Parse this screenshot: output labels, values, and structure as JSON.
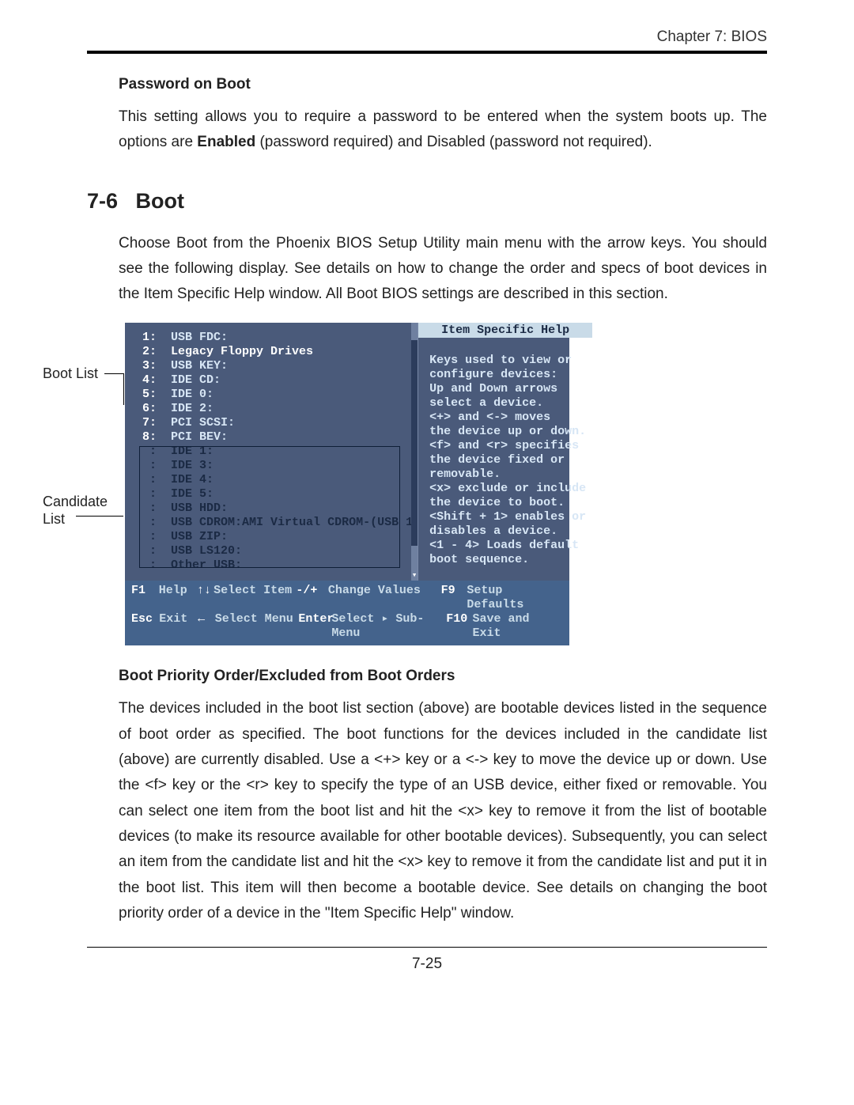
{
  "chapter_header": "Chapter 7: BIOS",
  "password_on_boot": {
    "heading": "Password on Boot",
    "para_pre": "This setting allows you to require a password to be entered when the system boots up.  The options are ",
    "bold": "Enabled",
    "para_post": " (password required) and Disabled (password not required)."
  },
  "section": {
    "num": "7-6",
    "title": "Boot",
    "intro": "Choose Boot from the Phoenix BIOS Setup Utility main menu with the arrow keys.  You should see the following display.  See details on how to change the order and specs of boot devices in the Item Specific Help window.  All Boot BIOS settings are described in this section."
  },
  "fig_labels": {
    "boot_list": "Boot List",
    "candidate_list_1": "Candidate",
    "candidate_list_2": "List"
  },
  "bios": {
    "boot_list": [
      {
        "num": "1:",
        "text": "USB FDC:"
      },
      {
        "num": "2:",
        "text": "Legacy Floppy Drives"
      },
      {
        "num": "3:",
        "text": "USB KEY:"
      },
      {
        "num": "4:",
        "text": "IDE CD:"
      },
      {
        "num": "5:",
        "text": "IDE 0:"
      },
      {
        "num": "6:",
        "text": "IDE 2:"
      },
      {
        "num": "7:",
        "text": "PCI SCSI:"
      },
      {
        "num": "8:",
        "text": "PCI BEV:"
      }
    ],
    "candidate_list": [
      {
        "num": " :",
        "text": "IDE 1:"
      },
      {
        "num": " :",
        "text": "IDE 3:"
      },
      {
        "num": " :",
        "text": "IDE 4:"
      },
      {
        "num": " :",
        "text": "IDE 5:"
      },
      {
        "num": " :",
        "text": "USB HDD:"
      },
      {
        "num": " :",
        "text": "USB CDROM:AMI Virtual CDROM-(USB 1"
      },
      {
        "num": " :",
        "text": "USB ZIP:"
      },
      {
        "num": " :",
        "text": "USB LS120:"
      },
      {
        "num": " :",
        "text": "Other USB:"
      }
    ],
    "help_title": "Item Specific Help",
    "help_lines": [
      "Keys used to view or",
      "configure devices:",
      "Up and Down arrows",
      "select a device.",
      "<+> and <-> moves",
      "the device up or down.",
      "<f> and <r> specifies",
      "the device fixed or",
      "removable.",
      "<x> exclude or include",
      "the device to boot.",
      "<Shift + 1> enables or",
      "disables a device.",
      "<1 - 4> Loads default",
      "boot sequence."
    ],
    "legend": {
      "row1": {
        "k1": "F1",
        "a1": "Help",
        "sym1": "↑↓",
        "a2": "Select Item",
        "k2": "-/+",
        "a3": "Change Values",
        "k3": "F9",
        "a4": "Setup Defaults"
      },
      "row2": {
        "k1": "Esc",
        "a1": "Exit",
        "sym1": "←",
        "a2": "Select Menu",
        "k2": "Enter",
        "a3": "Select ▸ Sub-Menu",
        "k3": "F10",
        "a4": "Save and Exit"
      }
    }
  },
  "boot_priority": {
    "heading": "Boot Priority Order/Excluded from Boot Orders",
    "para": "The devices included in the boot list section (above) are bootable devices listed in the sequence of boot order as specified. The boot functions for the devices included in the candidate list (above) are currently disabled.  Use a <+> key or a <-> key to move the device up or down. Use the <f> key or the <r> key to specify the type of an USB device, either fixed or removable. You can select one item from the boot list and hit the <x> key to remove it from the list of bootable devices (to make its resource available for other bootable devices). Subsequently, you can select an item from the candidate list and hit the <x> key  to remove it from the candidate list and put it in the boot list. This item will then become a bootable device. See details on changing the boot priority order of a device in the \"Item Specific Help\" window."
  },
  "page_number": "7-25"
}
